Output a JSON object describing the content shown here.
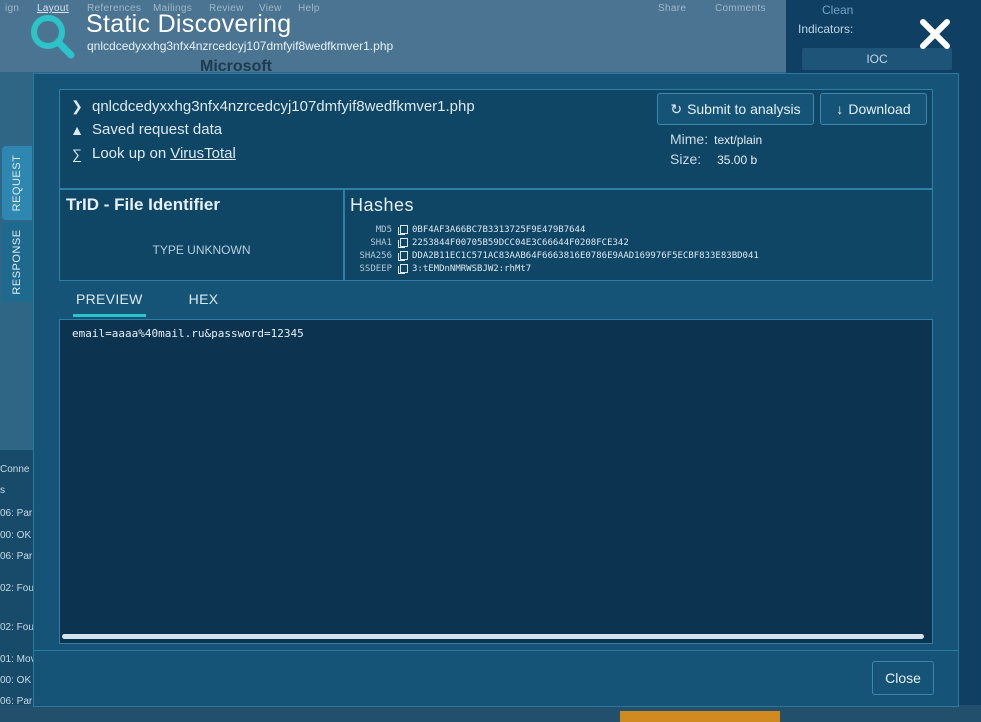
{
  "background": {
    "ribbon_tabs": [
      "ign",
      "Layout",
      "References",
      "Mailings",
      "Review",
      "View",
      "Help",
      "Share",
      "Comments"
    ],
    "doc_label": "Microsoft",
    "right_panel": {
      "status": "Clean",
      "indicators_label": "Indicators:",
      "ioc_label": "IOC"
    },
    "left_rows": [
      "Conne",
      "s",
      "06: Par",
      "00: OK",
      "06: Par",
      "02: Fou",
      "02: Fou",
      "01: Mov",
      "00: OK",
      "06: Par"
    ]
  },
  "header": {
    "title": "Static Discovering",
    "subtitle": "qnlcdcedyxxhg3nfx4nzrcedcyj107dmfyif8wedfkmver1.php"
  },
  "side_tabs": [
    {
      "label": "REQUEST",
      "active": true
    },
    {
      "label": "RESPONSE",
      "active": false
    }
  ],
  "info": {
    "filename": "qnlcdcedyxxhg3nfx4nzrcedcyj107dmfyif8wedfkmver1.php",
    "saved_label": "Saved request data",
    "lookup_prefix": "Look up on",
    "lookup_link": "VirusTotal",
    "submit_label": "Submit to analysis",
    "download_label": "Download",
    "mime_label": "Mime:",
    "mime_value": "text/plain",
    "size_label": "Size:",
    "size_value": "35.00 b"
  },
  "trid": {
    "title": "TrID - File Identifier",
    "type": "TYPE UNKNOWN"
  },
  "hashes": {
    "title": "Hashes",
    "rows": [
      {
        "label": "MD5",
        "value": "0BF4AF3A66BC7B3313725F9E479B7644"
      },
      {
        "label": "SHA1",
        "value": "2253844F00705B59DCC04E3C66644F0208FCE342"
      },
      {
        "label": "SHA256",
        "value": "DDA2B11EC1C571AC83AAB64F6663816E0786E9AAD169976F5ECBF833E83BD041"
      },
      {
        "label": "SSDEEP",
        "value": "3:tEMDnNMRWSBJW2:rhMt7"
      }
    ]
  },
  "tabs": [
    {
      "label": "PREVIEW",
      "active": true
    },
    {
      "label": "HEX",
      "active": false
    }
  ],
  "preview": {
    "content": "email=aaaa%40mail.ru&password=12345"
  },
  "footer": {
    "close_label": "Close"
  }
}
